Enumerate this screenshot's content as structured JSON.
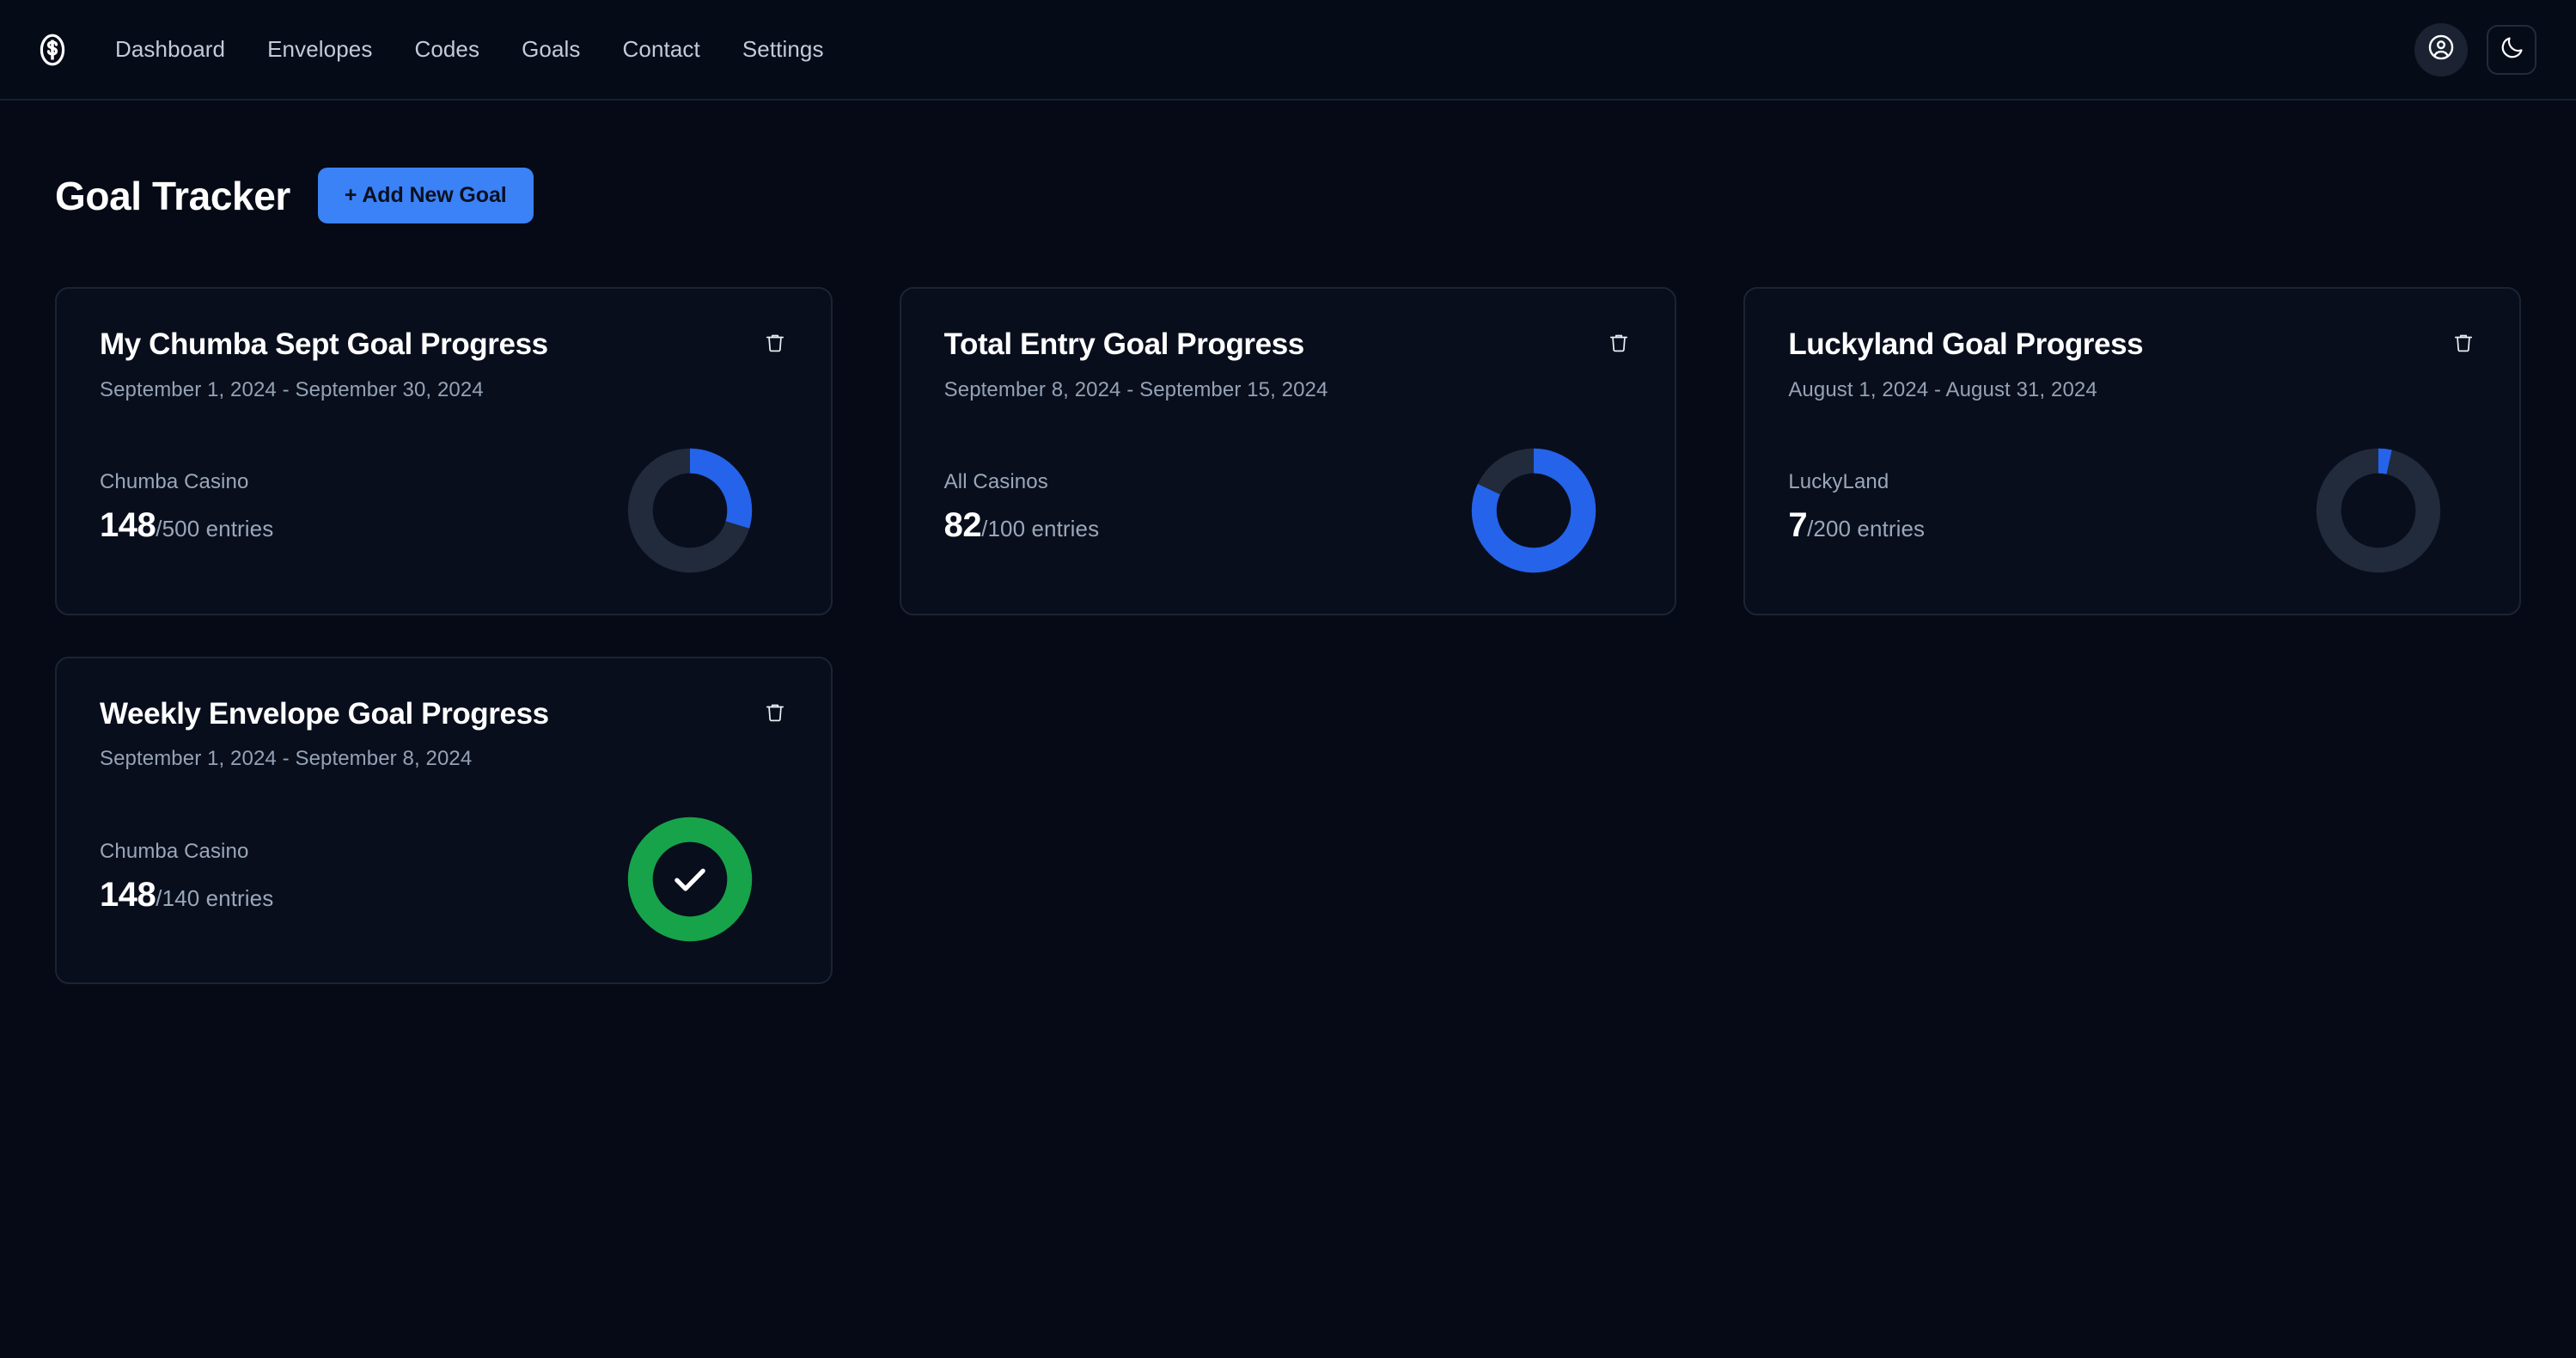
{
  "brand": {
    "logo_icon": "dollar-circle-icon"
  },
  "nav": {
    "links": [
      {
        "label": "Dashboard"
      },
      {
        "label": "Envelopes"
      },
      {
        "label": "Codes"
      },
      {
        "label": "Goals"
      },
      {
        "label": "Contact"
      },
      {
        "label": "Settings"
      }
    ],
    "account_icon": "user-circle-icon",
    "theme_icon": "moon-icon"
  },
  "header": {
    "title": "Goal Tracker",
    "add_button_label": "+ Add New Goal"
  },
  "colors": {
    "accent_blue": "#3b82f6",
    "progress_blue": "#2563eb",
    "complete_green": "#17a34a",
    "track": "#212b3c",
    "page_bg": "#050a16",
    "card_bg": "#080e1c",
    "card_border": "#1c2434"
  },
  "cards": [
    {
      "title": "My Chumba Sept Goal Progress",
      "dates": "September 1, 2024 - September 30, 2024",
      "source": "Chumba Casino",
      "current": "148",
      "total": "/500 entries",
      "delete_icon": "trash-icon",
      "chart_data": {
        "type": "pie",
        "title": "My Chumba Sept Goal Progress",
        "variant": "donut-progress",
        "value": 148,
        "max": 500,
        "percent": 29.6,
        "complete": false,
        "categories": [
          "completed",
          "remaining"
        ],
        "values": [
          148,
          352
        ],
        "colors": [
          "#2563eb",
          "#212b3c"
        ],
        "start_angle_deg": 0,
        "direction": "clockwise"
      }
    },
    {
      "title": "Total Entry Goal Progress",
      "dates": "September 8, 2024 - September 15, 2024",
      "source": "All Casinos",
      "current": "82",
      "total": "/100 entries",
      "delete_icon": "trash-icon",
      "chart_data": {
        "type": "pie",
        "title": "Total Entry Goal Progress",
        "variant": "donut-progress",
        "value": 82,
        "max": 100,
        "percent": 82,
        "complete": false,
        "categories": [
          "completed",
          "remaining"
        ],
        "values": [
          82,
          18
        ],
        "colors": [
          "#2563eb",
          "#212b3c"
        ],
        "start_angle_deg": 0,
        "direction": "clockwise"
      }
    },
    {
      "title": "Luckyland Goal Progress",
      "dates": "August 1, 2024 - August 31, 2024",
      "source": "LuckyLand",
      "current": "7",
      "total": "/200 entries",
      "delete_icon": "trash-icon",
      "chart_data": {
        "type": "pie",
        "title": "Luckyland Goal Progress",
        "variant": "donut-progress",
        "value": 7,
        "max": 200,
        "percent": 3.5,
        "complete": false,
        "categories": [
          "completed",
          "remaining"
        ],
        "values": [
          7,
          193
        ],
        "colors": [
          "#2563eb",
          "#212b3c"
        ],
        "start_angle_deg": 0,
        "direction": "clockwise"
      }
    },
    {
      "title": "Weekly Envelope Goal Progress",
      "dates": "September 1, 2024 - September 8, 2024",
      "source": "Chumba Casino",
      "current": "148",
      "total": "/140 entries",
      "delete_icon": "trash-icon",
      "status_icon": "check-icon",
      "chart_data": {
        "type": "pie",
        "title": "Weekly Envelope Goal Progress",
        "variant": "donut-progress",
        "value": 148,
        "max": 140,
        "percent": 100,
        "complete": true,
        "categories": [
          "completed",
          "remaining"
        ],
        "values": [
          140,
          0
        ],
        "colors": [
          "#17a34a",
          "#17a34a"
        ],
        "start_angle_deg": 0,
        "direction": "clockwise"
      }
    }
  ]
}
